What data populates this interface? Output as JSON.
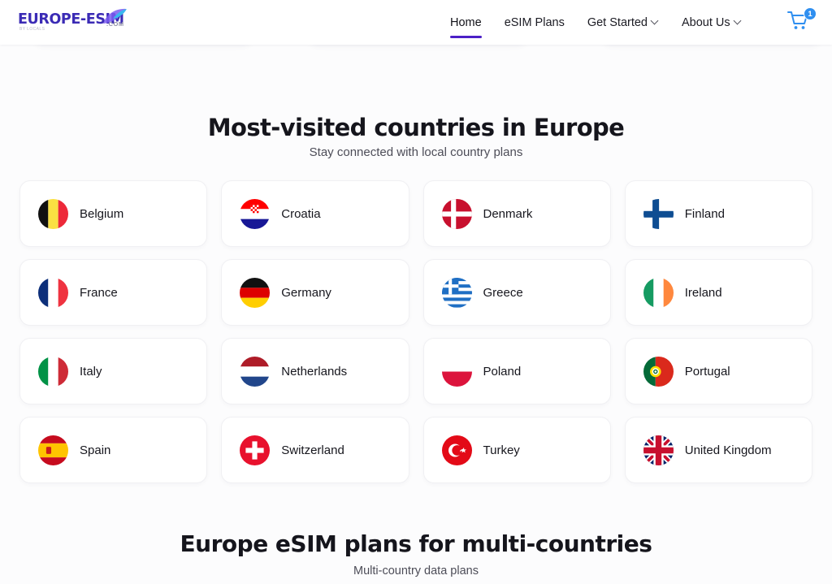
{
  "header": {
    "logo": {
      "main": "EUROPE-ESIM",
      "suffix": ".COM",
      "tagline": "BY LOCALS"
    },
    "nav": [
      {
        "label": "Home",
        "active": true,
        "caret": false
      },
      {
        "label": "eSIM Plans",
        "active": false,
        "caret": false
      },
      {
        "label": "Get Started",
        "active": false,
        "caret": true
      },
      {
        "label": "About Us",
        "active": false,
        "caret": true
      }
    ],
    "cart": {
      "icon": "shopping-cart-icon",
      "badge": "1"
    },
    "active_color": "#4b1fc7",
    "cart_color": "#2f8ff0"
  },
  "section_countries": {
    "title": "Most-visited countries in Europe",
    "subtitle": "Stay connected with local country plans",
    "countries": [
      {
        "name": "Belgium",
        "flag": "be"
      },
      {
        "name": "Croatia",
        "flag": "hr"
      },
      {
        "name": "Denmark",
        "flag": "dk"
      },
      {
        "name": "Finland",
        "flag": "fi"
      },
      {
        "name": "France",
        "flag": "fr"
      },
      {
        "name": "Germany",
        "flag": "de"
      },
      {
        "name": "Greece",
        "flag": "gr"
      },
      {
        "name": "Ireland",
        "flag": "ie"
      },
      {
        "name": "Italy",
        "flag": "it"
      },
      {
        "name": "Netherlands",
        "flag": "nl"
      },
      {
        "name": "Poland",
        "flag": "pl"
      },
      {
        "name": "Portugal",
        "flag": "pt"
      },
      {
        "name": "Spain",
        "flag": "es"
      },
      {
        "name": "Switzerland",
        "flag": "ch"
      },
      {
        "name": "Turkey",
        "flag": "tr"
      },
      {
        "name": "United Kingdom",
        "flag": "gb"
      }
    ]
  },
  "section_multi": {
    "title": "Europe eSIM plans for multi-countries",
    "subtitle": "Multi-country data plans"
  }
}
